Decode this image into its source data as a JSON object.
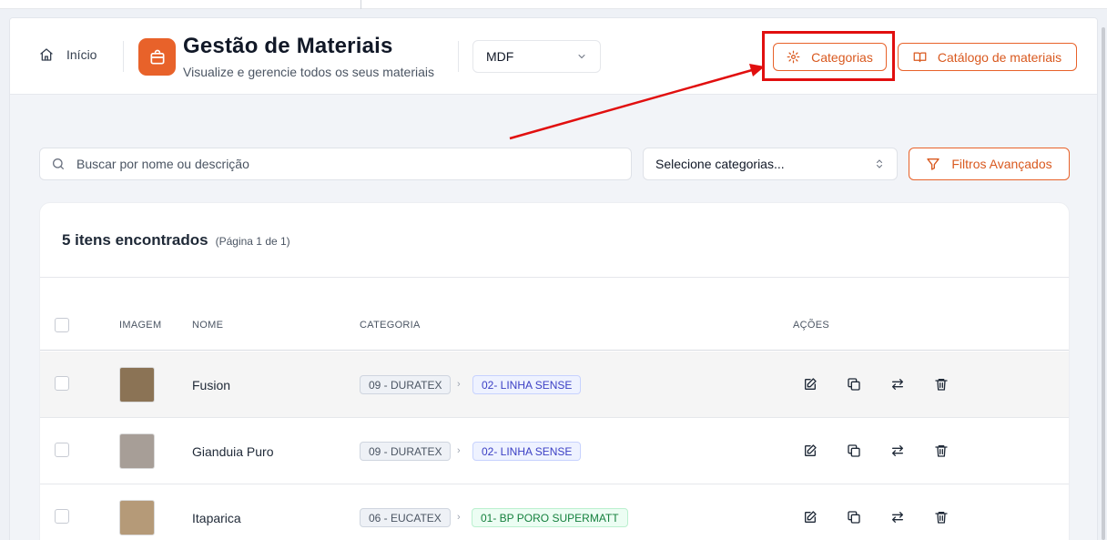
{
  "header": {
    "home_label": "Início",
    "title": "Gestão de Materiais",
    "subtitle": "Visualize e gerencie todos os seus materiais",
    "material_select": "MDF",
    "categories_button": "Categorias",
    "catalog_button": "Catálogo de materiais"
  },
  "toolbar": {
    "search_placeholder": "Buscar por nome ou descrição",
    "category_select": "Selecione categorias...",
    "filters_button": "Filtros Avançados"
  },
  "results": {
    "count_text": "5 itens encontrados",
    "page_text": "(Página 1 de 1)"
  },
  "table": {
    "columns": {
      "image": "IMAGEM",
      "name": "NOME",
      "category": "CATEGORIA",
      "actions": "AÇÕES"
    },
    "rows": [
      {
        "name": "Fusion",
        "swatch": "#8b7355",
        "brand": "09 - DURATEX",
        "line": "02- LINHA SENSE",
        "line_style": "blue"
      },
      {
        "name": "Gianduia Puro",
        "swatch": "#a79e97",
        "brand": "09 - DURATEX",
        "line": "02- LINHA SENSE",
        "line_style": "blue"
      },
      {
        "name": "Itaparica",
        "swatch": "#b59a78",
        "brand": "06 - EUCATEX",
        "line": "01- BP PORO SUPERMATT",
        "line_style": "green"
      }
    ]
  },
  "colors": {
    "accent": "#e8622a",
    "annotation": "#e10f0f"
  },
  "icons": {
    "home": "home-icon",
    "app": "shopping-bag-icon",
    "settings": "gear-icon",
    "catalog": "book-open-icon",
    "search": "search-icon",
    "filter": "filter-icon",
    "edit": "edit-icon",
    "copy": "copy-icon",
    "transfer": "transfer-icon",
    "delete": "trash-icon"
  }
}
